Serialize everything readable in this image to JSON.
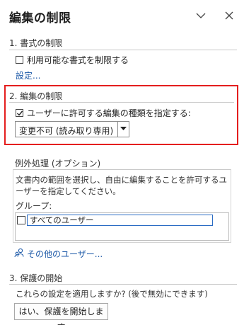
{
  "pane": {
    "title": "編集の制限"
  },
  "section1": {
    "heading": "1. 書式の制限",
    "checkbox_label": "利用可能な書式を制限する",
    "checked": false,
    "settings_link": "設定..."
  },
  "section2": {
    "heading": "2. 編集の制限",
    "checkbox_label": "ユーザーに許可する編集の種類を指定する:",
    "checked": true,
    "dropdown_value": "変更不可 (読み取り専用)"
  },
  "exceptions": {
    "heading": "例外処理 (オプション)",
    "description": "文書内の範囲を選択し、自由に編集することを許可するユーザーを指定してください。",
    "group_label": "グループ:",
    "groups": [
      {
        "name": "すべてのユーザー",
        "checked": false
      }
    ],
    "more_users_link": "その他のユーザー..."
  },
  "section3": {
    "heading": "3. 保護の開始",
    "prompt": "これらの設定を適用しますか? (後で無効にできます)",
    "start_button": "はい、保護を開始します"
  },
  "colors": {
    "highlight": "#e41e1e",
    "link": "#1e5aa8"
  },
  "icons": [
    "chevron-down-icon",
    "close-icon",
    "checkmark-icon",
    "dropdown-arrow-icon",
    "users-icon"
  ]
}
